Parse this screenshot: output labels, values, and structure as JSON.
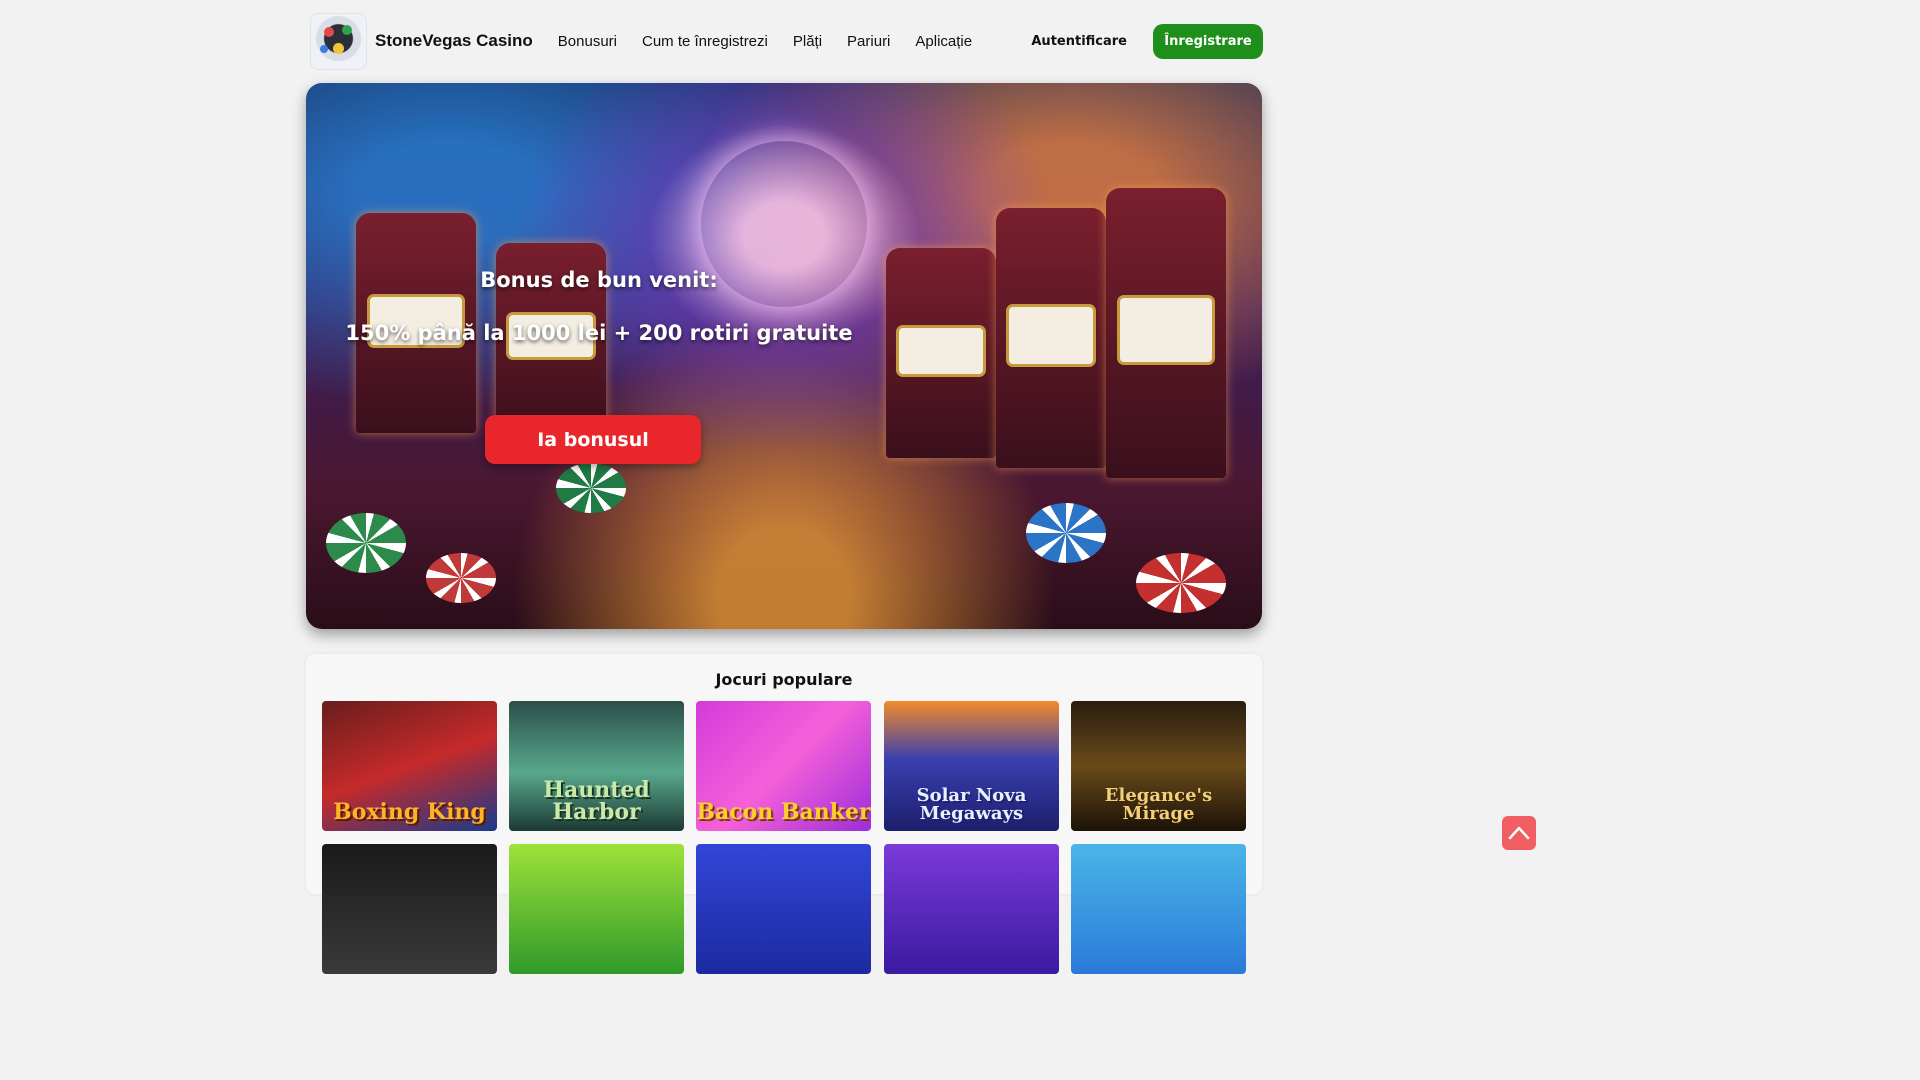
{
  "header": {
    "brand": "StoneVegas Casino",
    "nav": [
      "Bonusuri",
      "Cum te înregistrezi",
      "Plăți",
      "Pariuri",
      "Aplicație"
    ],
    "login": "Autentificare",
    "register": "Înregistrare"
  },
  "hero": {
    "title": "Bonus de bun venit:",
    "subtitle": "150% până la 1000 lei + 200 rotiri gratuite",
    "cta": "Ia bonusul"
  },
  "games": {
    "heading": "Jocuri populare",
    "tiles": [
      {
        "name": "Boxing King"
      },
      {
        "name": "Haunted Harbor"
      },
      {
        "name": "Bacon Banker"
      },
      {
        "name": "Solar Nova Megaways"
      },
      {
        "name": "Elegance's Mirage"
      }
    ]
  },
  "colors": {
    "register": "#1f8f1c",
    "cta": "#e8262b",
    "scroll_top": "#f05e63"
  },
  "icons": {
    "scroll_top": "chevron-up-icon",
    "logo": "casino-logo-icon"
  }
}
